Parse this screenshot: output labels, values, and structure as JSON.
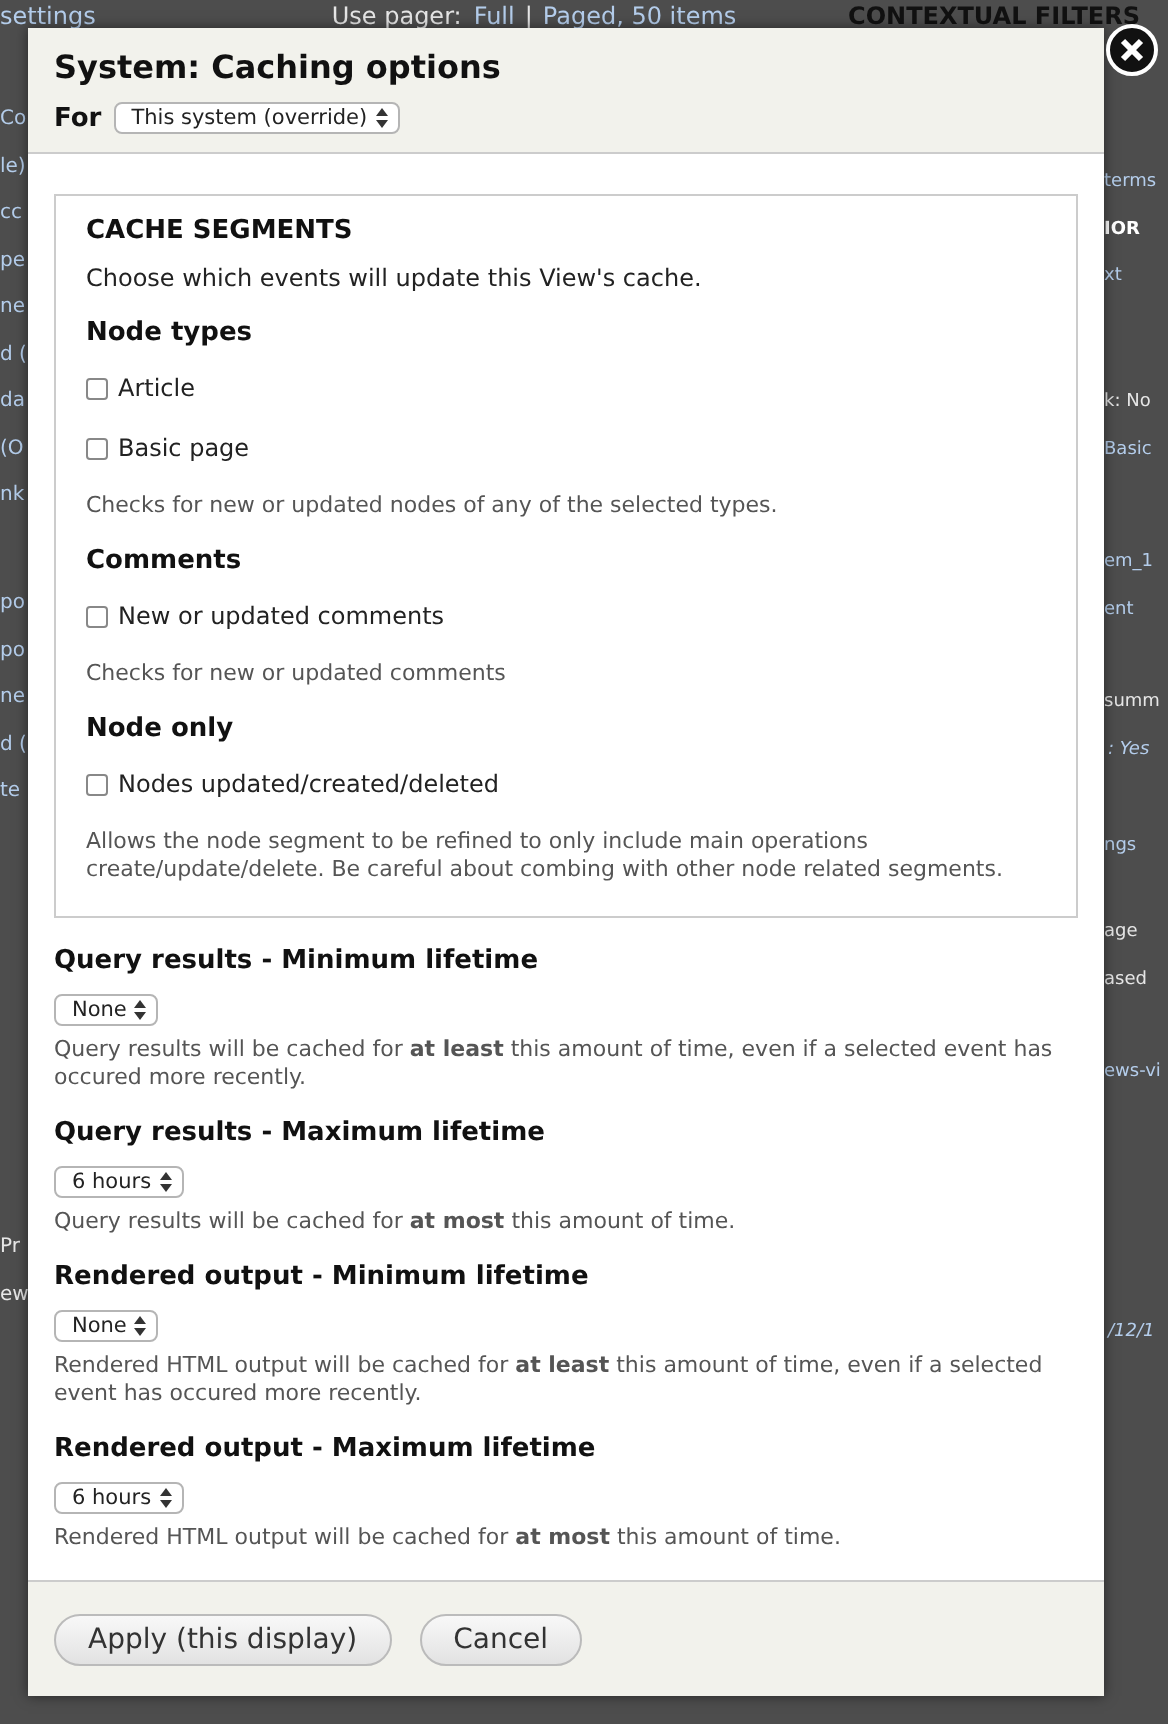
{
  "background": {
    "top_link": "settings",
    "pager_label": "Use pager:",
    "pager_links": [
      "Full",
      "Paged, 50 items"
    ],
    "pager_separator": "|",
    "section_heading": "CONTEXTUAL FILTERS",
    "left_fragments": [
      [
        {
          "text": "Co",
          "kind": "link"
        },
        {
          "text": "le)",
          "kind": "link"
        },
        {
          "text": "cc",
          "kind": "link"
        },
        {
          "text": "pe",
          "kind": "link"
        },
        {
          "text": "ne",
          "kind": "link"
        },
        {
          "text": "d (",
          "kind": "link"
        },
        {
          "text": "da",
          "kind": "link"
        },
        {
          "text": "(O",
          "kind": "link"
        },
        {
          "text": "nk",
          "kind": "link"
        }
      ],
      [
        {
          "text": "po",
          "kind": "link"
        },
        {
          "text": "po",
          "kind": "link"
        },
        {
          "text": "ne",
          "kind": "link"
        },
        {
          "text": "d (",
          "kind": "link"
        },
        {
          "text": "te",
          "kind": "link"
        }
      ],
      [
        {
          "text": "Pr",
          "kind": "plain"
        },
        {
          "text": "ew",
          "kind": "plain"
        }
      ]
    ],
    "right_fragments": [
      [
        {
          "text": "terms",
          "kind": "link"
        },
        {
          "text": "IOR",
          "kind": "heading"
        },
        {
          "text": "xt",
          "kind": "link"
        }
      ],
      [
        {
          "text": "k: No",
          "kind": "plain"
        },
        {
          "text": "Basic",
          "kind": "link"
        }
      ],
      [
        {
          "text": "em_1",
          "kind": "link"
        },
        {
          "text": "ent",
          "kind": "link"
        }
      ],
      [
        {
          "text": "summ",
          "kind": "plain"
        },
        {
          "text": ": Yes",
          "kind": "italic"
        }
      ],
      [
        {
          "text": "ngs",
          "kind": "link"
        }
      ],
      [
        {
          "text": "age",
          "kind": "plain"
        },
        {
          "text": "ased",
          "kind": "plain"
        }
      ],
      [
        {
          "text": "ews-vi",
          "kind": "link"
        }
      ],
      [
        {
          "text": "/12/1",
          "kind": "italic"
        }
      ]
    ]
  },
  "dialog": {
    "title": "System: Caching options",
    "for_label": "For",
    "for_select": "This system (override)",
    "segments": {
      "legend": "CACHE SEGMENTS",
      "intro": "Choose which events will update this View's cache.",
      "groups": [
        {
          "heading": "Node types",
          "options": [
            {
              "label": "Article",
              "checked": false
            },
            {
              "label": "Basic page",
              "checked": false
            }
          ],
          "description": "Checks for new or updated nodes of any of the selected types."
        },
        {
          "heading": "Comments",
          "options": [
            {
              "label": "New or updated comments",
              "checked": false
            }
          ],
          "description": "Checks for new or updated comments"
        },
        {
          "heading": "Node only",
          "options": [
            {
              "label": "Nodes updated/created/deleted",
              "checked": false
            }
          ],
          "description": "Allows the node segment to be refined to only include main operations create/update/delete. Be careful about combing with other node related segments."
        }
      ]
    },
    "lifetimes": [
      {
        "label": "Query results - Minimum lifetime",
        "value": "None",
        "description": "Query results will be cached for **at least** this amount of time, even if a selected event has occured more recently."
      },
      {
        "label": "Query results - Maximum lifetime",
        "value": "6 hours",
        "description": "Query results will be cached for **at most** this amount of time."
      },
      {
        "label": "Rendered output - Minimum lifetime",
        "value": "None",
        "description": "Rendered HTML output will be cached for **at least** this amount of time, even if a selected event has occured more recently."
      },
      {
        "label": "Rendered output - Maximum lifetime",
        "value": "6 hours",
        "description": "Rendered HTML output will be cached for **at most** this amount of time."
      }
    ],
    "buttons": [
      "Apply (this display)",
      "Cancel"
    ]
  }
}
